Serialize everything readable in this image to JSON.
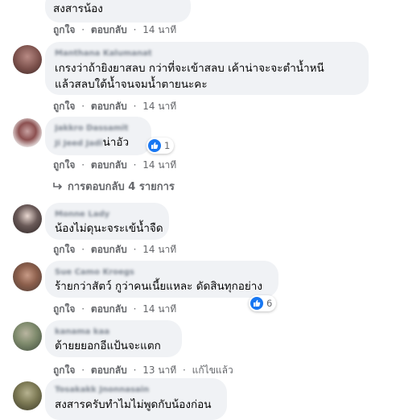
{
  "actions": {
    "like": "ถูกใจ",
    "reply": "ตอบกลับ",
    "dot": "·",
    "edited": "แก้ไขแล้ว"
  },
  "comments": [
    {
      "author": "",
      "lines": [
        "สงสารน้อง"
      ],
      "time": "14 นาที"
    },
    {
      "author": "Manthana Kalumanat",
      "lines": [
        "เกรงว่าถ้ายิงยาสลบ กว่าที่จะเข้าสลบ เค้าน่าจะจะตำน้ำหนี",
        "แล้วสลบใต้น้ำจนจมน้ำตายนะคะ"
      ],
      "time": "14 นาที"
    },
    {
      "author": "Jakkro Dassamit",
      "mention": "Ji Jeed Jadi",
      "lines": [
        "น่าอัว"
      ],
      "time": "14 นาที",
      "reaction_count": "1",
      "replies": "การตอบกลับ 4 รายการ"
    },
    {
      "author": "Monne Lady",
      "lines": [
        "น้องไม่ดุนะจระเข้น้ำจืด"
      ],
      "time": "14 นาที"
    },
    {
      "author": "Sue Camo Kroegs",
      "lines": [
        "ร้ายกว่าสัตว์ กูว่าคนเนี้ยแหละ ดัดสินทุกอย่าง"
      ],
      "time": "14 นาที",
      "reaction_count": "6"
    },
    {
      "author": "kanama kaa",
      "lines": [
        "ต้ายยยอกอีแป้นจะแตก"
      ],
      "time": "13 นาที",
      "edited": true
    },
    {
      "author": "Tosakakk Jnonnasain",
      "lines": [
        "สงสารครับทำไมไม่พูดกับน้องก่อน"
      ]
    }
  ],
  "colors": {
    "accent": "#1877f2",
    "bubble": "#f0f2f5",
    "meta": "#65676b"
  }
}
